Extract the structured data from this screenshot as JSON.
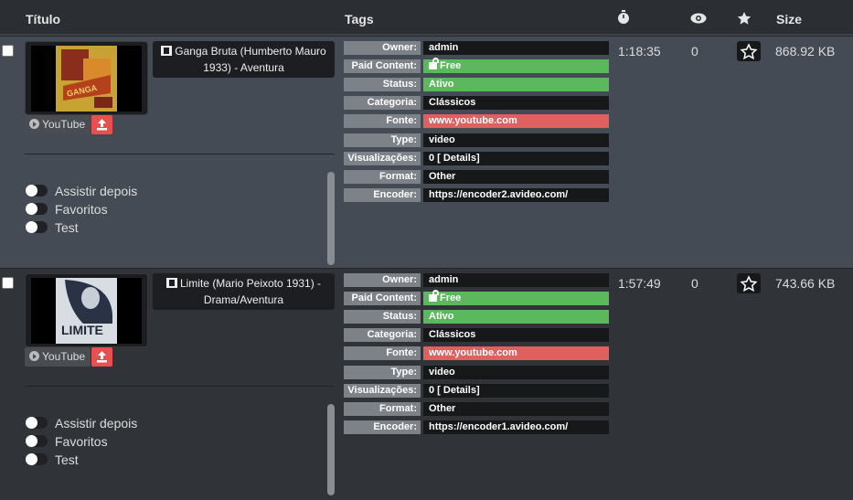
{
  "header": {
    "title": "Título",
    "tags": "Tags",
    "size": "Size"
  },
  "rows": [
    {
      "title": "Ganga Bruta (Humberto Mauro 1933) - Aventura",
      "source_button": "YouTube",
      "toggles": [
        "Assistir depois",
        "Favoritos",
        "Test"
      ],
      "tags": [
        {
          "k": "Owner:",
          "v": "admin",
          "style": "dark"
        },
        {
          "k": "Paid Content:",
          "v": "Free",
          "style": "green",
          "icon": "unlock-icon"
        },
        {
          "k": "Status:",
          "v": "Ativo",
          "style": "green"
        },
        {
          "k": "Categoria:",
          "v": "Clássicos",
          "style": "dark"
        },
        {
          "k": "Fonte:",
          "v": "www.youtube.com",
          "style": "red"
        },
        {
          "k": "Type:",
          "v": "video",
          "style": "dark"
        },
        {
          "k": "Visualizações:",
          "v": "0 [ Details]",
          "style": "dark",
          "icon": "info-icon"
        },
        {
          "k": "Format:",
          "v": "Other",
          "style": "dark"
        },
        {
          "k": "Encoder:",
          "v": "https://encoder2.avideo.com/",
          "style": "dark"
        }
      ],
      "duration": "1:18:35",
      "views": "0",
      "size": "868.92 KB",
      "poster_colors": {
        "bg": "#c9a234",
        "accent": "#b3421c"
      }
    },
    {
      "title": "Limite (Mario Peixoto 1931) - Drama/Aventura",
      "source_button": "YouTube",
      "toggles": [
        "Assistir depois",
        "Favoritos",
        "Test"
      ],
      "tags": [
        {
          "k": "Owner:",
          "v": "admin",
          "style": "dark"
        },
        {
          "k": "Paid Content:",
          "v": "Free",
          "style": "green",
          "icon": "unlock-icon"
        },
        {
          "k": "Status:",
          "v": "Ativo",
          "style": "green"
        },
        {
          "k": "Categoria:",
          "v": "Clássicos",
          "style": "dark"
        },
        {
          "k": "Fonte:",
          "v": "www.youtube.com",
          "style": "red"
        },
        {
          "k": "Type:",
          "v": "video",
          "style": "dark"
        },
        {
          "k": "Visualizações:",
          "v": "0 [ Details]",
          "style": "dark",
          "icon": "info-icon"
        },
        {
          "k": "Format:",
          "v": "Other",
          "style": "dark"
        },
        {
          "k": "Encoder:",
          "v": "https://encoder1.avideo.com/",
          "style": "dark"
        }
      ],
      "duration": "1:57:49",
      "views": "0",
      "size": "743.66 KB",
      "poster_colors": {
        "bg": "#d8dde4",
        "accent": "#2a3346"
      }
    }
  ],
  "colors": {
    "green": "#5cb85c",
    "red": "#e0605f",
    "upload": "#e85050",
    "row_alt": "#454b54"
  }
}
